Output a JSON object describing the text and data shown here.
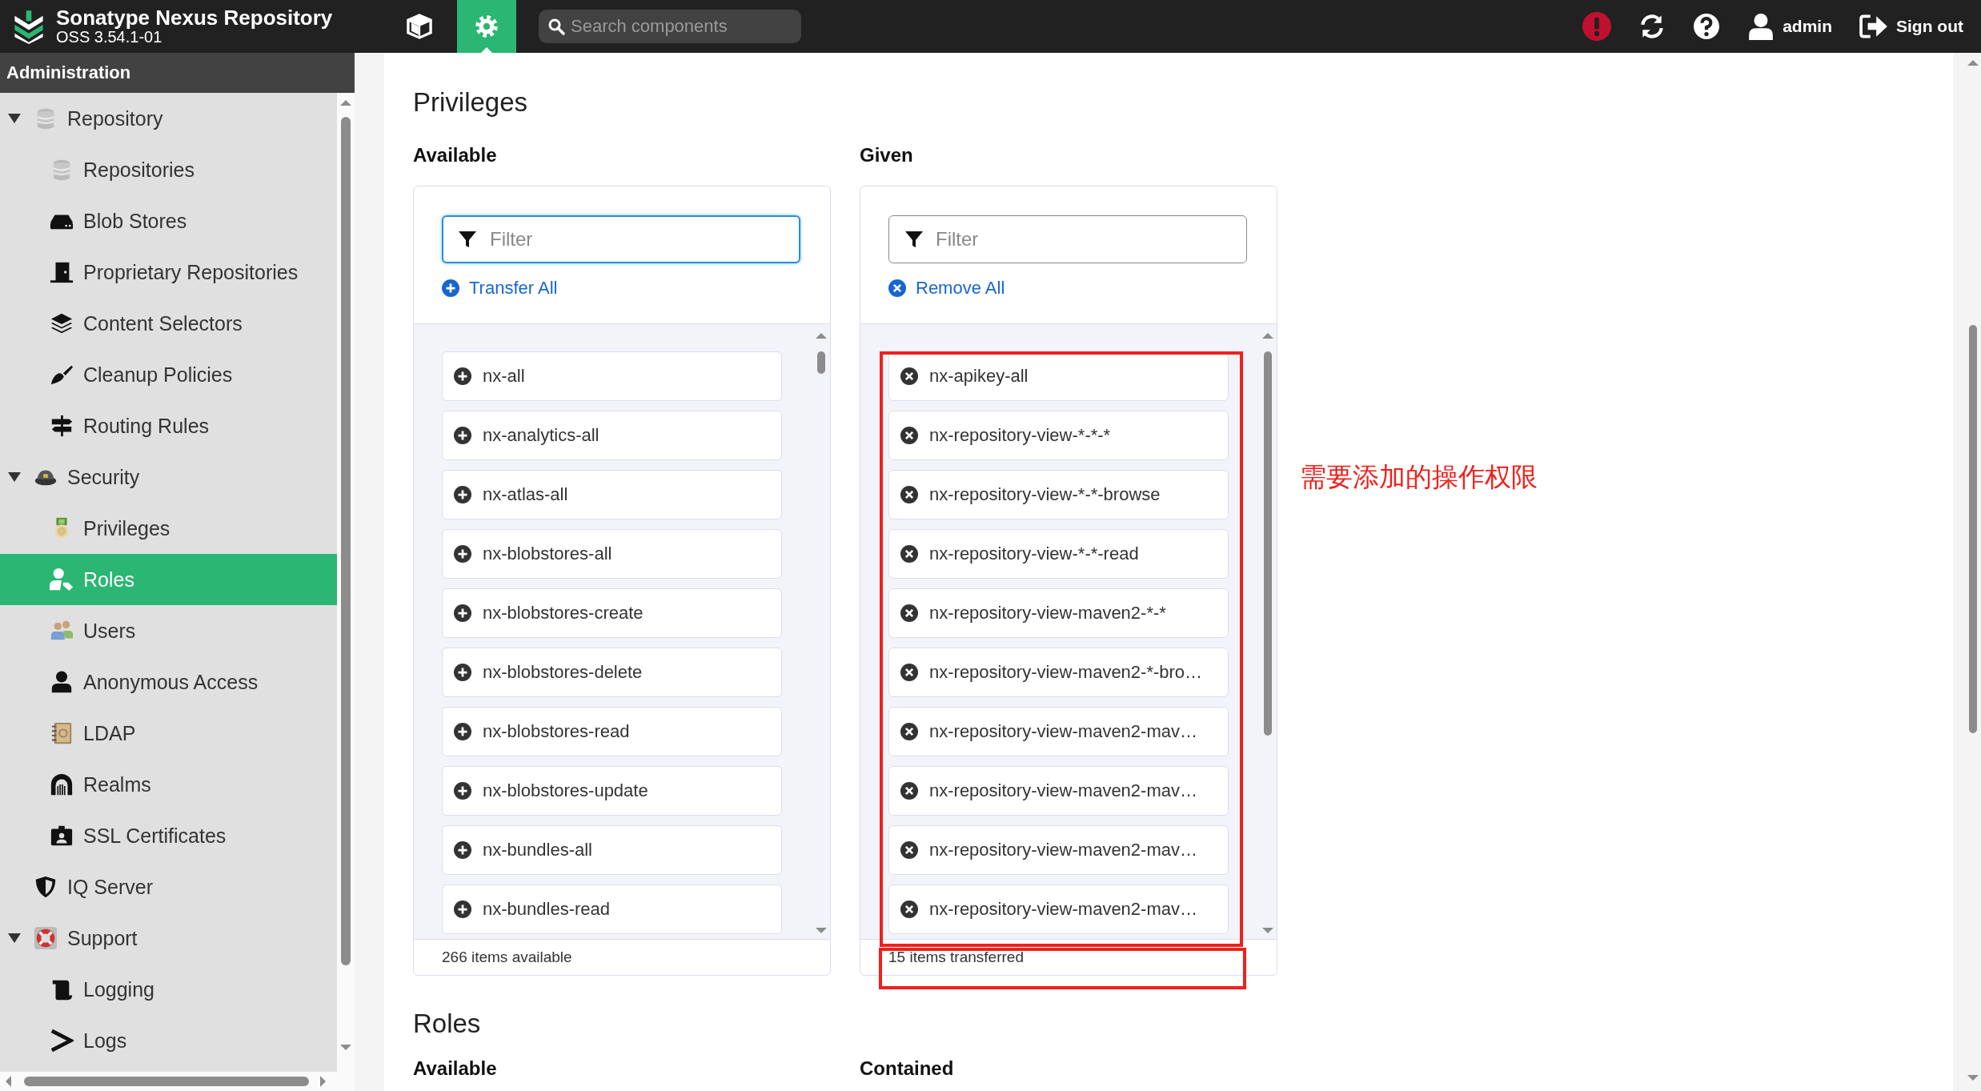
{
  "header": {
    "title": "Sonatype Nexus Repository",
    "version": "OSS 3.54.1-01",
    "search_placeholder": "Search components",
    "user": "admin",
    "sign_out": "Sign out"
  },
  "sidebar": {
    "title": "Administration",
    "items": [
      {
        "label": "Repository",
        "expanded": true,
        "selected": false,
        "children": [
          {
            "label": "Repositories",
            "selected": false
          },
          {
            "label": "Blob Stores",
            "selected": false
          },
          {
            "label": "Proprietary Repositories",
            "selected": false
          },
          {
            "label": "Content Selectors",
            "selected": false
          },
          {
            "label": "Cleanup Policies",
            "selected": false
          },
          {
            "label": "Routing Rules",
            "selected": false
          }
        ]
      },
      {
        "label": "Security",
        "expanded": true,
        "selected": false,
        "children": [
          {
            "label": "Privileges",
            "selected": false
          },
          {
            "label": "Roles",
            "selected": true
          },
          {
            "label": "Users",
            "selected": false
          },
          {
            "label": "Anonymous Access",
            "selected": false
          },
          {
            "label": "LDAP",
            "selected": false
          },
          {
            "label": "Realms",
            "selected": false
          },
          {
            "label": "SSL Certificates",
            "selected": false
          }
        ]
      },
      {
        "label": "IQ Server",
        "selected": false
      },
      {
        "label": "Support",
        "expanded": true,
        "selected": false,
        "children": [
          {
            "label": "Logging",
            "selected": false
          },
          {
            "label": "Logs",
            "selected": false
          }
        ]
      }
    ]
  },
  "privileges": {
    "title": "Privileges",
    "available": {
      "label": "Available",
      "filter_placeholder": "Filter",
      "focused": true,
      "action": "Transfer All",
      "kind": "add",
      "items": [
        "nx-all",
        "nx-analytics-all",
        "nx-atlas-all",
        "nx-blobstores-all",
        "nx-blobstores-create",
        "nx-blobstores-delete",
        "nx-blobstores-read",
        "nx-blobstores-update",
        "nx-bundles-all",
        "nx-bundles-read"
      ],
      "footer": "266 items available"
    },
    "given": {
      "label": "Given",
      "filter_placeholder": "Filter",
      "focused": false,
      "action": "Remove All",
      "kind": "remove",
      "annotated": true,
      "items": [
        "nx-apikey-all",
        "nx-repository-view-*-*-*",
        "nx-repository-view-*-*-browse",
        "nx-repository-view-*-*-read",
        "nx-repository-view-maven2-*-*",
        "nx-repository-view-maven2-*-bro…",
        "nx-repository-view-maven2-mav…",
        "nx-repository-view-maven2-mav…",
        "nx-repository-view-maven2-mav…",
        "nx-repository-view-maven2-mav…"
      ],
      "footer": "15 items transferred"
    },
    "annotation": "需要添加的操作权限"
  },
  "roles": {
    "title": "Roles",
    "available_label": "Available",
    "contained_label": "Contained"
  }
}
